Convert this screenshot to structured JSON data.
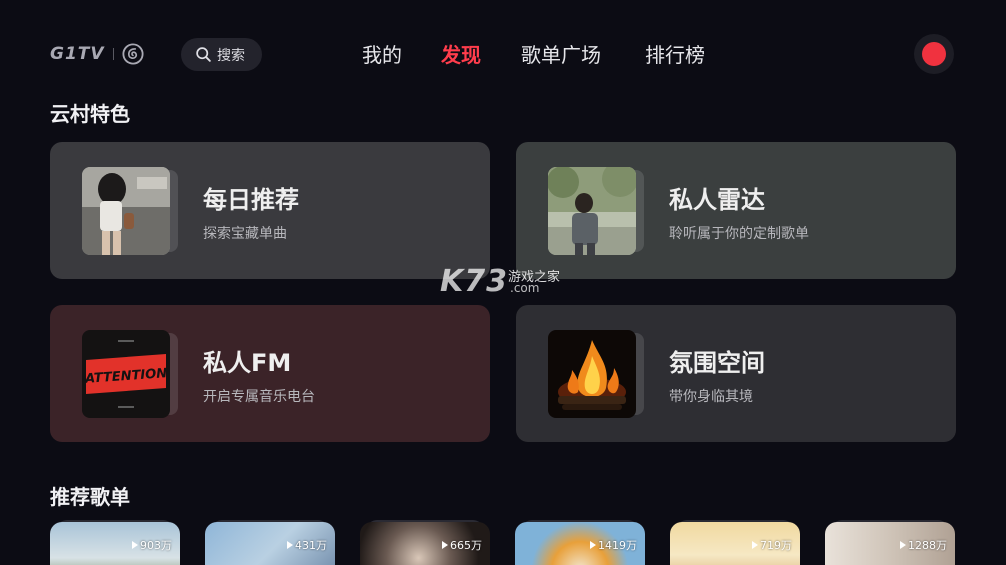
{
  "header": {
    "logo_text": "G1TV",
    "search_label": "搜索",
    "tabs": [
      {
        "label": "我的",
        "active": false
      },
      {
        "label": "发现",
        "active": true
      },
      {
        "label": "歌单广场",
        "active": false
      },
      {
        "label": "排行榜",
        "active": false
      }
    ],
    "record_color": "#f0323f",
    "accent_color": "#ff3d4c"
  },
  "featured": {
    "title": "云村特色",
    "cards": [
      {
        "title": "每日推荐",
        "subtitle": "探索宝藏单曲",
        "bg": "#3a3a3e"
      },
      {
        "title": "私人雷达",
        "subtitle": "聆听属于你的定制歌单",
        "bg": "#3b3f3f"
      },
      {
        "title": "私人FM",
        "subtitle": "开启专属音乐电台",
        "bg": "#3b2328"
      },
      {
        "title": "氛围空间",
        "subtitle": "带你身临其境",
        "bg": "#2e2e33"
      }
    ],
    "fm_cover_text": "ATTENTION"
  },
  "playlists": {
    "title": "推荐歌单",
    "items": [
      {
        "play_count": "903万"
      },
      {
        "play_count": "431万"
      },
      {
        "play_count": "665万"
      },
      {
        "play_count": "1419万"
      },
      {
        "play_count": "719万"
      },
      {
        "play_count": "1288万"
      }
    ]
  },
  "watermark": {
    "brand": "K73",
    "text": "游戏之家",
    "domain": ".com"
  }
}
